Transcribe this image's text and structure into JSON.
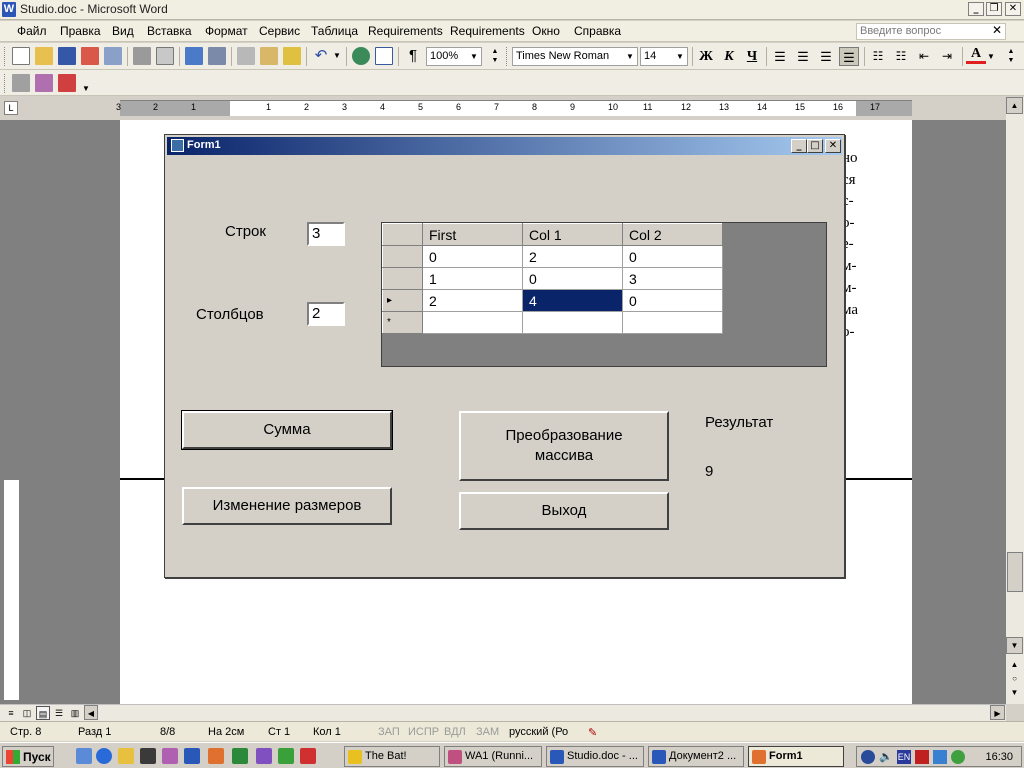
{
  "word": {
    "title": "Studio.doc - Microsoft Word",
    "menu": [
      "Файл",
      "Правка",
      "Вид",
      "Вставка",
      "Формат",
      "Сервис",
      "Таблица",
      "Requirements",
      "Requirements",
      "Окно",
      "Справка"
    ],
    "ask_placeholder": "Введите вопрос",
    "zoom": "100%",
    "font": "Times New Roman",
    "font_size": "14",
    "ruler_numbers": [
      "3",
      "2",
      "1",
      "1",
      "2",
      "3",
      "4",
      "5",
      "6",
      "7",
      "8",
      "9",
      "10",
      "11",
      "12",
      "13",
      "14",
      "15",
      "16",
      "17"
    ],
    "page_text_right": [
      "но",
      "ся",
      "с-",
      "о-",
      "е-",
      "м-",
      "м-",
      "ма",
      "о-"
    ]
  },
  "form": {
    "title": "Form1",
    "rows_label": "Строк",
    "rows_value": "3",
    "cols_label": "Столбцов",
    "cols_value": "2",
    "grid": {
      "headers": [
        "First",
        "Col 1",
        "Col 2"
      ],
      "rows": [
        [
          "0",
          "2",
          "0"
        ],
        [
          "1",
          "0",
          "3"
        ],
        [
          "2",
          "4",
          "0"
        ]
      ],
      "new_row_marker": "*",
      "current_row_marker": "▸"
    },
    "sum_button": "Сумма",
    "resize_button": "Изменение размеров",
    "transform_button": "Преобразование массива",
    "exit_button": "Выход",
    "result_label": "Результат",
    "result_value": "9"
  },
  "status": {
    "page": "Стр. 8",
    "section": "Разд 1",
    "pages": "8/8",
    "at": "На 2см",
    "line": "Ст 1",
    "col": "Кол 1",
    "rec": "ЗАП",
    "trk": "ИСПР",
    "ext": "ВДЛ",
    "ovr": "ЗАМ",
    "lang": "русский (Ро"
  },
  "taskbar": {
    "start": "Пуск",
    "tasks": [
      "The Bat!",
      "WA1 (Runni...",
      "Studio.doc - ...",
      "Документ2 ...",
      "Form1"
    ],
    "tray_lang": "EN",
    "clock": "16:30"
  }
}
